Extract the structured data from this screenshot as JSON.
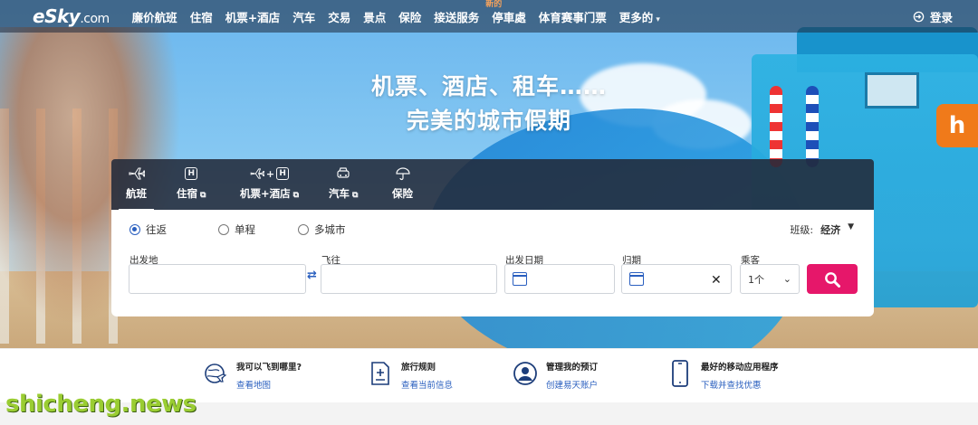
{
  "header": {
    "logo": "eSky",
    "logo_suffix": ".com",
    "nav": [
      {
        "label": "廉价航班"
      },
      {
        "label": "住宿"
      },
      {
        "label": "机票+酒店"
      },
      {
        "label": "汽车"
      },
      {
        "label": "交易"
      },
      {
        "label": "景点"
      },
      {
        "label": "保险"
      },
      {
        "label": "接送服务"
      },
      {
        "label": "停車處",
        "badge": "新的"
      },
      {
        "label": "体育赛事门票"
      },
      {
        "label": "更多的"
      }
    ],
    "login": "登录"
  },
  "hero": {
    "line1": "机票、酒店、租车……",
    "line2": "完美的城市假期",
    "brand_badge": "h"
  },
  "tabs": [
    {
      "label": "航班",
      "icon": "plane-icon",
      "active": true
    },
    {
      "label": "住宿",
      "icon": "hotel-icon",
      "external": true
    },
    {
      "label": "机票+酒店",
      "icon": "plane-hotel-icon",
      "external": true
    },
    {
      "label": "汽车",
      "icon": "car-icon",
      "external": true
    },
    {
      "label": "保险",
      "icon": "umbrella-icon"
    }
  ],
  "search": {
    "trip_types": [
      "往返",
      "单程",
      "多城市"
    ],
    "selected_trip": "往返",
    "cabin_label": "班级:",
    "cabin_value": "经济",
    "from_label": "出发地",
    "to_label": "飞往",
    "depart_label": "出发日期",
    "return_label": "归期",
    "pax_label": "乘客",
    "pax_value": "1个"
  },
  "info": [
    {
      "title": "我可以飞到哪里?",
      "link": "查看地图",
      "icon": "globe-plane-icon"
    },
    {
      "title": "旅行规则",
      "link": "查看当前信息",
      "icon": "document-plus-icon"
    },
    {
      "title": "管理我的预订",
      "link": "创建易天账户",
      "icon": "user-circle-icon"
    },
    {
      "title": "最好的移动应用程序",
      "link": "下载并查找优惠",
      "icon": "mobile-phone-icon"
    }
  ],
  "watermark": "shicheng.news",
  "colors": {
    "accent": "#e6176a",
    "link": "#2a5fbf"
  }
}
